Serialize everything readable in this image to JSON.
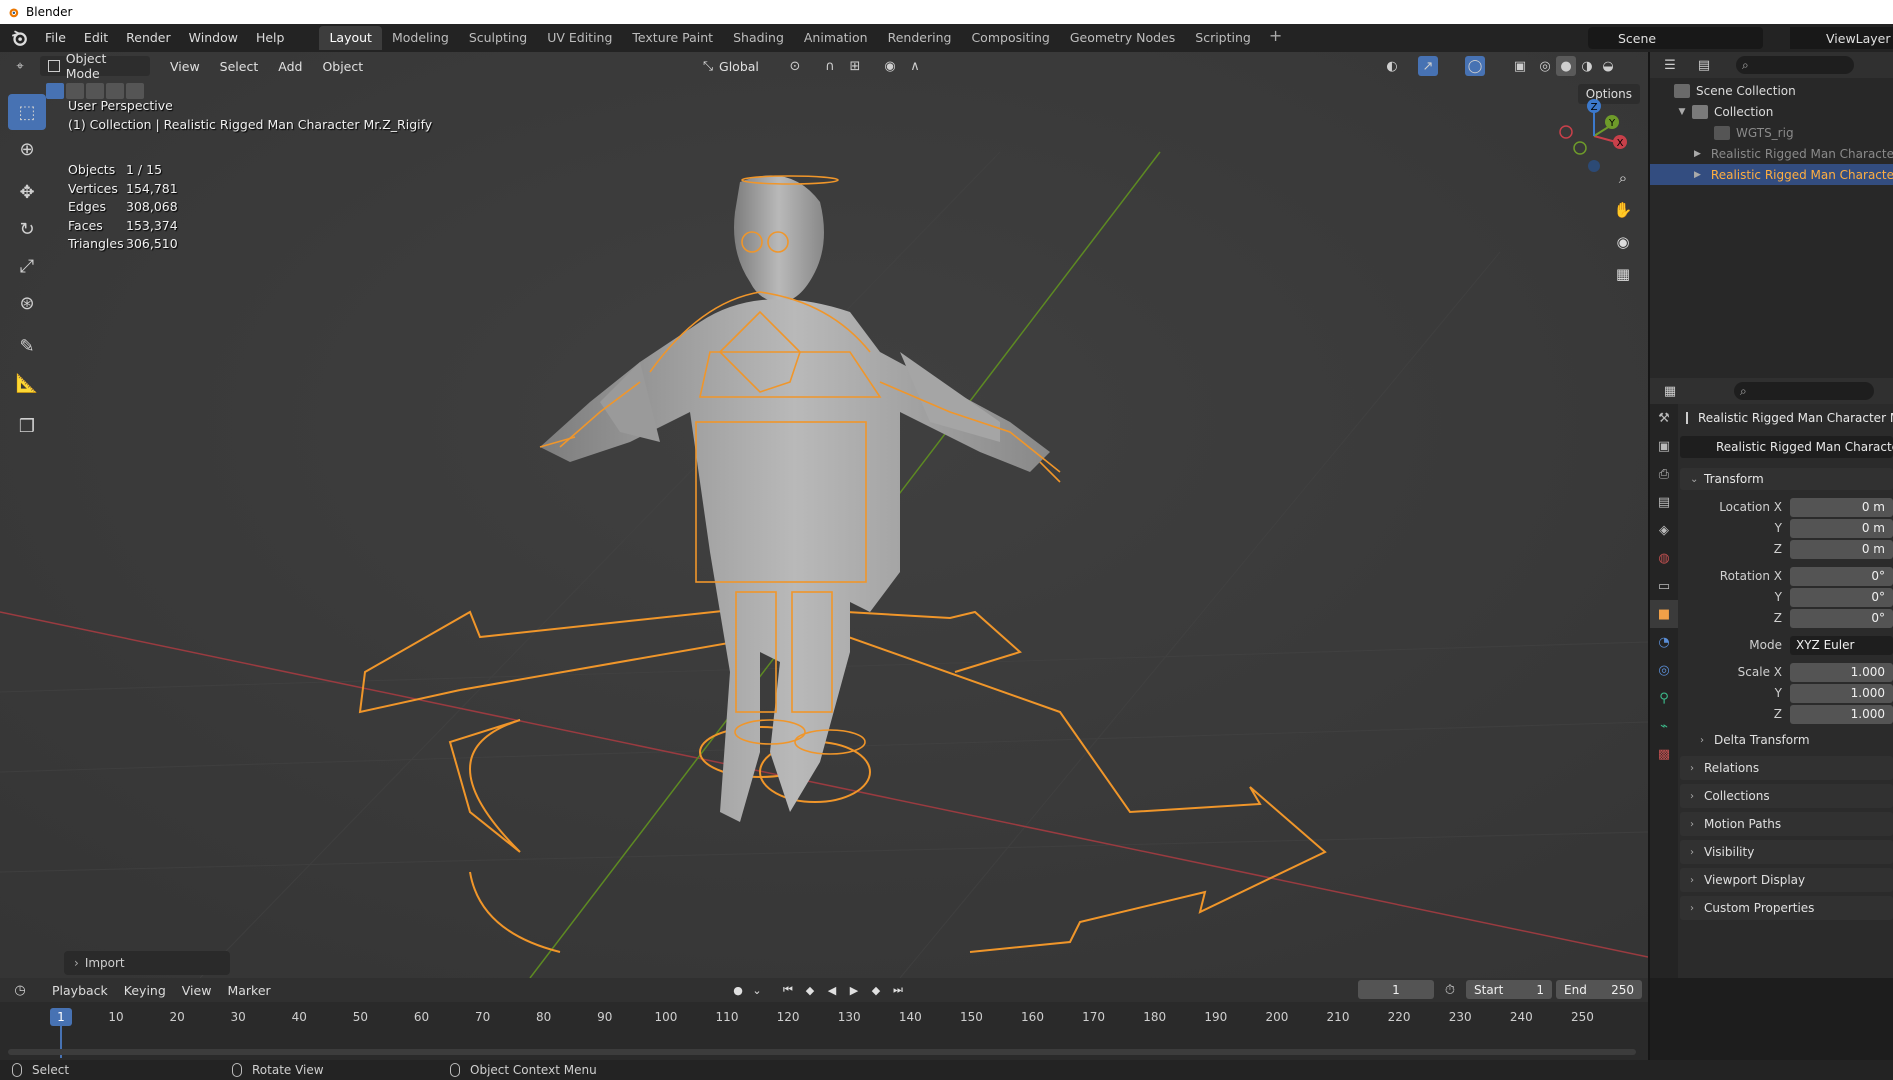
{
  "os": {
    "title": "Blender"
  },
  "menu": {
    "items": [
      "File",
      "Edit",
      "Render",
      "Window",
      "Help"
    ],
    "workspaces": [
      "Layout",
      "Modeling",
      "Sculpting",
      "UV Editing",
      "Texture Paint",
      "Shading",
      "Animation",
      "Rendering",
      "Compositing",
      "Geometry Nodes",
      "Scripting"
    ],
    "active_workspace": "Layout",
    "add_icon": "plus-icon",
    "scene": "Scene",
    "view_layer": "ViewLayer"
  },
  "viewport": {
    "mode": "Object Mode",
    "menus": [
      "View",
      "Select",
      "Add",
      "Object"
    ],
    "transform_orientation": "Global",
    "options_label": "Options",
    "perspective_label": "User Perspective",
    "collection_label": "(1) Collection | Realistic Rigged Man Character Mr.Z_Rigify",
    "stats": [
      {
        "key": "Objects",
        "value": "1 / 15"
      },
      {
        "key": "Vertices",
        "value": "154,781"
      },
      {
        "key": "Edges",
        "value": "308,068"
      },
      {
        "key": "Faces",
        "value": "153,374"
      },
      {
        "key": "Triangles",
        "value": "306,510"
      }
    ],
    "gizmo_labels": {
      "x": "X",
      "y": "Y",
      "z": "Z"
    },
    "import_label": "Import",
    "tools": [
      "select-box-icon",
      "cursor-icon",
      "move-icon",
      "rotate-icon",
      "scale-icon",
      "transform-icon",
      "annotate-icon",
      "measure-icon",
      "add-cube-icon"
    ]
  },
  "outliner": {
    "rows": [
      {
        "label": "Scene Collection",
        "type": "scene"
      },
      {
        "label": "Collection",
        "type": "collection"
      },
      {
        "label": "WGTS_rig",
        "type": "child"
      },
      {
        "label": "Realistic Rigged Man Character",
        "type": "child"
      },
      {
        "label": "Realistic Rigged Man Character",
        "type": "selected"
      }
    ]
  },
  "properties": {
    "object_name": "Realistic Rigged Man Character Mr.Z",
    "object_field": "Realistic Rigged Man Character",
    "transform_label": "Transform",
    "location": {
      "label_x": "Location X",
      "x": "0 m",
      "y": "0 m",
      "z": "0 m"
    },
    "rotation": {
      "label_x": "Rotation X",
      "x": "0°",
      "y": "0°",
      "z": "0°"
    },
    "mode_label": "Mode",
    "mode_value": "XYZ Euler",
    "scale": {
      "label_x": "Scale X",
      "x": "1.000",
      "y": "1.000",
      "z": "1.000"
    },
    "axis_y": "Y",
    "axis_z": "Z",
    "delta_transform": "Delta Transform",
    "sections": [
      "Relations",
      "Collections",
      "Motion Paths",
      "Visibility",
      "Viewport Display",
      "Custom Properties"
    ]
  },
  "timeline": {
    "menus": [
      "Playback",
      "Keying",
      "View",
      "Marker"
    ],
    "current_frame": "1",
    "start_label": "Start",
    "start": "1",
    "end_label": "End",
    "end": "250",
    "ticks": [
      "10",
      "20",
      "30",
      "40",
      "50",
      "60",
      "70",
      "80",
      "90",
      "100",
      "110",
      "120",
      "130",
      "140",
      "150",
      "160",
      "170",
      "180",
      "190",
      "200",
      "210",
      "220",
      "230",
      "240",
      "250"
    ]
  },
  "status": {
    "select": "Select",
    "rotate_view": "Rotate View",
    "context_menu": "Object Context Menu"
  },
  "colors": {
    "accent_blue": "#4772b3",
    "rig_orange": "#f0962a",
    "x_axis": "#c8404a",
    "y_axis": "#6e9b2a",
    "selection_text": "#ffae40"
  }
}
